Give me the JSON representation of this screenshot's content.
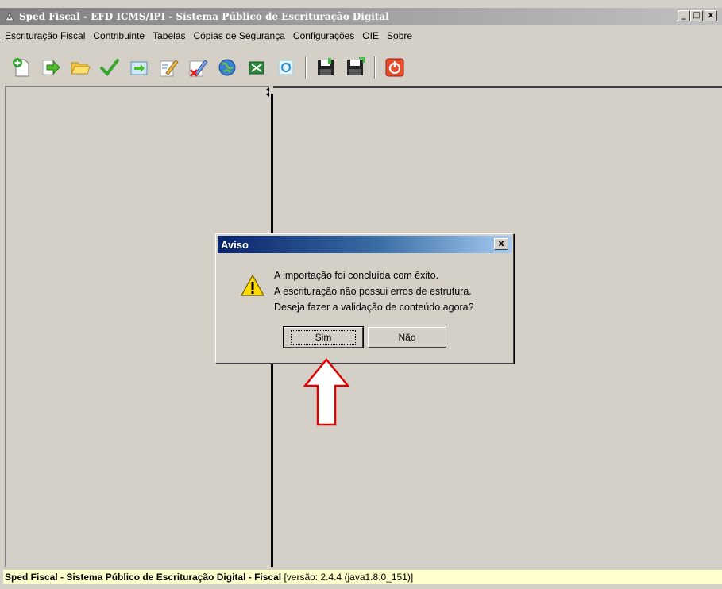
{
  "window": {
    "title": "Sped Fiscal - EFD ICMS/IPI - Sistema Público de Escrituração Digital",
    "controls": {
      "minimize": "_",
      "maximize": "□",
      "close": "x"
    }
  },
  "menu": [
    {
      "label": "Escrituração Fiscal",
      "mnemonic": "E",
      "rest": "scrituração Fiscal"
    },
    {
      "label": "Contribuinte",
      "mnemonic": "C",
      "rest": "ontribuinte"
    },
    {
      "label": "Tabelas",
      "mnemonic": "T",
      "rest": "abelas"
    },
    {
      "label": "Cópias de Segurança",
      "pre": "Cópias de ",
      "mnemonic": "S",
      "rest": "egurança"
    },
    {
      "label": "Configurações",
      "pre": "Con",
      "mnemonic": "f",
      "rest": "igurações"
    },
    {
      "label": "OIE",
      "mnemonic": "O",
      "rest": "IE"
    },
    {
      "label": "Sobre",
      "pre": "S",
      "mnemonic": "o",
      "rest": "bre"
    }
  ],
  "toolbar": {
    "icons": [
      "new-document-icon",
      "import-arrow-icon",
      "open-folder-icon",
      "validate-check-icon",
      "export-icon",
      "edit-pencil-icon",
      "delete-edit-icon",
      "globe-transmit-icon",
      "receipt-icon",
      "refresh-icon",
      "save-icon",
      "save-as-icon",
      "power-exit-icon"
    ]
  },
  "colors": {
    "window_bg": "#d4d0c8",
    "status_bg": "#ffffcc",
    "dialog_title_start": "#0a246a",
    "dialog_title_end": "#a6caf0",
    "annotation_arrow": "#e00000"
  },
  "dialog": {
    "title": "Aviso",
    "close": "x",
    "icon": "warning-icon",
    "lines": [
      "A importação foi concluída com êxito.",
      "A escrituração não possui erros de estrutura.",
      "Deseja fazer a validação de conteúdo agora?"
    ],
    "buttons": {
      "yes": "Sim",
      "no": "Não"
    }
  },
  "status": {
    "bold": "Sped Fiscal - Sistema Público de Escrituração Digital - Fiscal",
    "normal": " [versão: 2.4.4 (java1.8.0_151)]"
  }
}
